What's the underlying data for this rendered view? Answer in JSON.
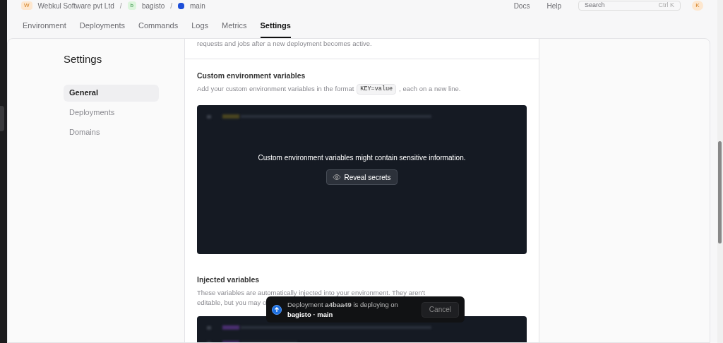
{
  "topbar": {
    "org": "Webkul Software pvt Ltd",
    "org_badge": "W",
    "project": "bagisto",
    "project_badge": "b",
    "branch": "main",
    "separators": [
      "/",
      "/"
    ],
    "links": [
      "Docs",
      "Help"
    ],
    "search": {
      "placeholder": "Search",
      "shortcut": "Ctrl K"
    },
    "avatar": "K"
  },
  "tabs": [
    {
      "label": "Environment",
      "selected": false
    },
    {
      "label": "Deployments",
      "selected": false
    },
    {
      "label": "Commands",
      "selected": false
    },
    {
      "label": "Logs",
      "selected": false
    },
    {
      "label": "Metrics",
      "selected": false
    },
    {
      "label": "Settings",
      "selected": true
    }
  ],
  "sidebar": {
    "title": "Settings",
    "items": [
      {
        "label": "General",
        "selected": true
      },
      {
        "label": "Deployments",
        "selected": false
      },
      {
        "label": "Domains",
        "selected": false
      }
    ]
  },
  "sections": [
    {
      "kind": "tail",
      "description": "requests and jobs after a new deployment becomes active."
    },
    {
      "kind": "custom",
      "title": "Custom environment variables",
      "description_before": "Add your custom environment variables in the format",
      "code": "KEY=value",
      "description_after": ", each on a new line.",
      "notice": "Custom environment variables might contain sensitive information.",
      "button": "Reveal secrets"
    },
    {
      "kind": "injected",
      "title": "Injected variables",
      "description_lines": [
        "These variables are automatically injected into your environment. They aren't",
        "editable, but you may o"
      ]
    }
  ],
  "toast": {
    "message": "Deployment **a4baa49** is deploying on",
    "target": "bagisto · main",
    "button": "Cancel"
  }
}
